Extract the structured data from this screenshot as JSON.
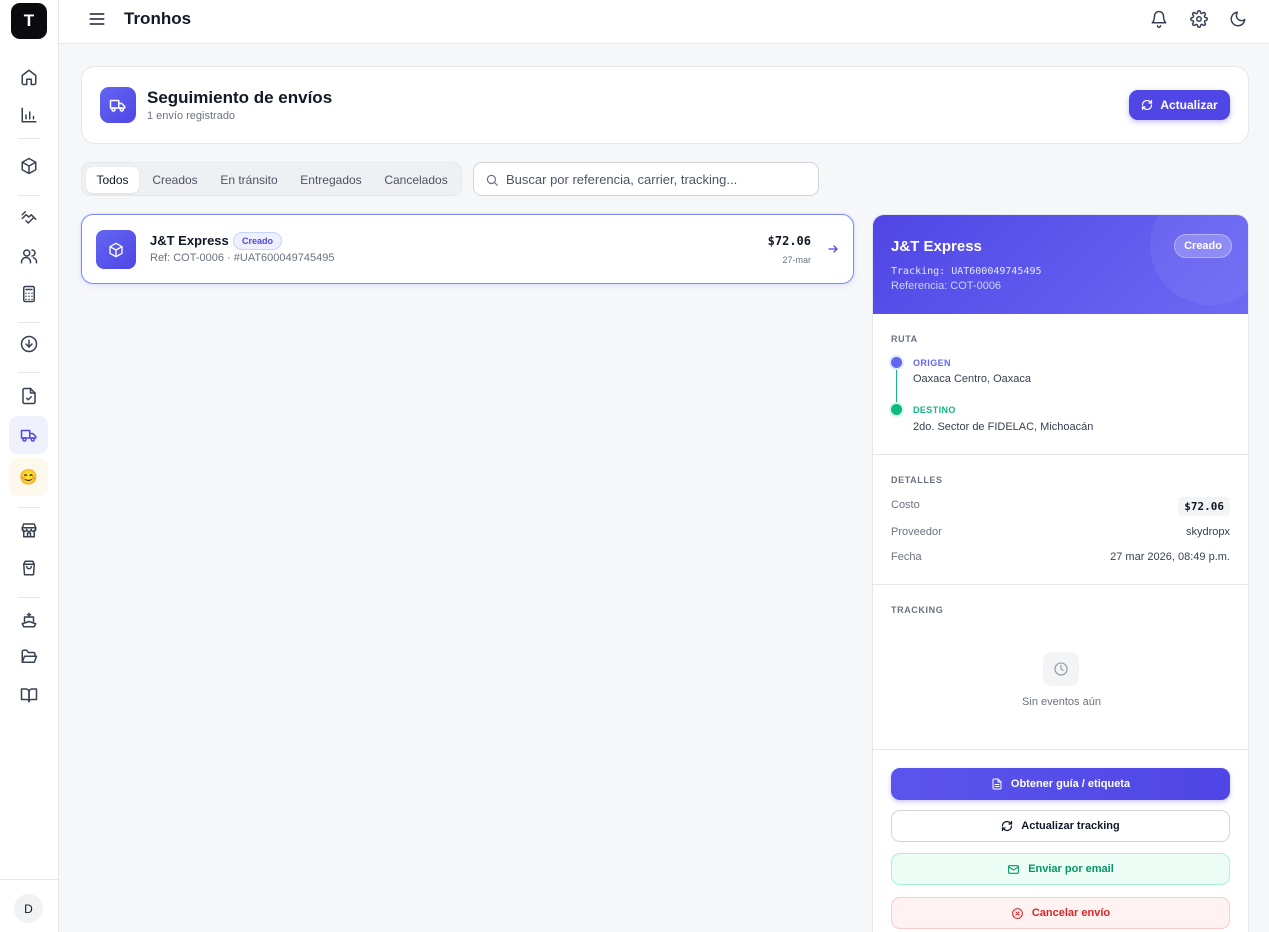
{
  "app": {
    "logo_letter": "T",
    "title": "Tronhos"
  },
  "user": {
    "avatar_initial": "D"
  },
  "sidebar": {
    "items": [
      {
        "icon": "home-icon"
      },
      {
        "icon": "bar-chart-icon"
      },
      {
        "icon": "package-icon"
      },
      {
        "icon": "handshake-icon"
      },
      {
        "icon": "users-icon"
      },
      {
        "icon": "calculator-icon"
      },
      {
        "icon": "download-icon"
      },
      {
        "icon": "file-check-icon"
      },
      {
        "icon": "truck-icon",
        "active": true
      },
      {
        "icon": "emoji-icon",
        "glyph": "😊"
      },
      {
        "icon": "store-icon"
      },
      {
        "icon": "shopping-bag-icon"
      },
      {
        "icon": "ship-icon"
      },
      {
        "icon": "folder-open-icon"
      },
      {
        "icon": "book-open-icon"
      }
    ]
  },
  "topbar": {
    "icons": [
      "bell-icon",
      "gear-icon",
      "moon-icon"
    ]
  },
  "header": {
    "title": "Seguimiento de envíos",
    "subtitle": "1 envío registrado",
    "refresh_label": "Actualizar"
  },
  "filters": {
    "tabs": [
      {
        "label": "Todos",
        "active": true
      },
      {
        "label": "Creados"
      },
      {
        "label": "En tránsito"
      },
      {
        "label": "Entregados"
      },
      {
        "label": "Cancelados"
      }
    ],
    "search_placeholder": "Buscar por referencia, carrier, tracking..."
  },
  "shipments": [
    {
      "carrier": "J&T Express",
      "status": "Creado",
      "ref_line": "Ref: COT-0006 · #UAT600049745495",
      "price": "$72.06",
      "date": "27-mar"
    }
  ],
  "detail": {
    "carrier": "J&T Express",
    "status": "Creado",
    "tracking_line": "Tracking: UAT600049745495",
    "reference_line": "Referencia: COT-0006",
    "route_label": "RUTA",
    "origin_label": "ORIGEN",
    "origin_value": "Oaxaca Centro, Oaxaca",
    "destination_label": "DESTINO",
    "destination_value": "2do. Sector de FIDELAC, Michoacán",
    "details_label": "DETALLES",
    "cost_key": "Costo",
    "cost_value": "$72.06",
    "provider_key": "Proveedor",
    "provider_value": "skydropx",
    "date_key": "Fecha",
    "date_value": "27 mar 2026, 08:49 p.m.",
    "tracking_label": "TRACKING",
    "empty_events": "Sin eventos aún",
    "actions": {
      "label_btn": "Obtener guía / etiqueta",
      "update_btn": "Actualizar tracking",
      "email_btn": "Enviar por email",
      "cancel_btn": "Cancelar envío"
    }
  },
  "colors": {
    "accent": "#4f46e5",
    "origin_dot": "#6366f1",
    "destination_dot": "#10b981",
    "success": "#059669",
    "danger": "#dc2626"
  }
}
